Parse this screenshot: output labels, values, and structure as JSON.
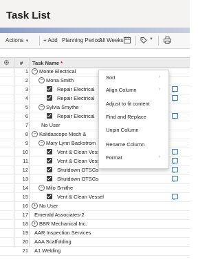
{
  "page": {
    "title": "Task List"
  },
  "toolbar": {
    "actions_label": "Actions",
    "add_label": "+ Add",
    "period_label": "Planning Period:",
    "period_value": "All Weeks"
  },
  "grid": {
    "row_header": "#",
    "name_header": "Task Name",
    "required_mark": "*",
    "rows": [
      {
        "num": "1",
        "name": "Monte Electrical",
        "toggle": "−",
        "check": false,
        "comment": false,
        "indent": 0
      },
      {
        "num": "2",
        "name": "Mona Smith",
        "toggle": "−",
        "check": false,
        "comment": false,
        "indent": 1
      },
      {
        "num": "3",
        "name": "Repair Electrical",
        "toggle": "",
        "check": true,
        "comment": true,
        "indent": 2
      },
      {
        "num": "4",
        "name": "Repair Electrical",
        "toggle": "",
        "check": true,
        "comment": true,
        "indent": 2
      },
      {
        "num": "5",
        "name": "Sylvia Smythe",
        "toggle": "−",
        "check": false,
        "comment": false,
        "indent": 1
      },
      {
        "num": "6",
        "name": "Repair Electrical",
        "toggle": "",
        "check": true,
        "comment": true,
        "indent": 2
      },
      {
        "num": "7",
        "name": "No User",
        "toggle": "",
        "check": false,
        "comment": false,
        "indent": 1
      },
      {
        "num": "8",
        "name": "Kalidascope Mech &",
        "toggle": "−",
        "check": false,
        "comment": false,
        "indent": 0
      },
      {
        "num": "9",
        "name": "Mary Lynn Backstrom",
        "toggle": "−",
        "check": false,
        "comment": false,
        "indent": 1
      },
      {
        "num": "10",
        "name": "Vent & Clean Vessel",
        "toggle": "",
        "check": true,
        "comment": true,
        "indent": 2
      },
      {
        "num": "11",
        "name": "Vent & Clean Vessel",
        "toggle": "",
        "check": true,
        "comment": true,
        "indent": 2
      },
      {
        "num": "12",
        "name": "Shutdown OTSGs",
        "toggle": "",
        "check": true,
        "comment": true,
        "indent": 2
      },
      {
        "num": "13",
        "name": "Shutdown OTSGs",
        "toggle": "",
        "check": true,
        "comment": true,
        "indent": 2
      },
      {
        "num": "14",
        "name": "Milo Smithe",
        "toggle": "−",
        "check": false,
        "comment": false,
        "indent": 1
      },
      {
        "num": "15",
        "name": "Vent & Clean Vessel",
        "toggle": "",
        "check": true,
        "comment": true,
        "indent": 2
      },
      {
        "num": "16",
        "name": "No User",
        "toggle": "+",
        "check": false,
        "comment": false,
        "indent": 0
      },
      {
        "num": "17",
        "name": "Emerald Associates-2",
        "toggle": "",
        "check": false,
        "comment": false,
        "indent": 0
      },
      {
        "num": "18",
        "name": "BBR Mechanical Inc.",
        "toggle": "+",
        "check": false,
        "comment": false,
        "indent": 0
      },
      {
        "num": "19",
        "name": "AAR Inspection Services",
        "toggle": "",
        "check": false,
        "comment": false,
        "indent": 0
      },
      {
        "num": "20",
        "name": "AAA Scaffolding",
        "toggle": "",
        "check": false,
        "comment": false,
        "indent": 0
      },
      {
        "num": "21",
        "name": "A1 Welding",
        "toggle": "",
        "check": false,
        "comment": false,
        "indent": 0
      }
    ]
  },
  "context_menu": {
    "items": [
      {
        "label": "Sort",
        "submenu": true
      },
      {
        "label": "Align Column",
        "submenu": true
      },
      {
        "label": "Adjust to fit content",
        "submenu": false
      },
      {
        "label": "Find and Replace",
        "submenu": false
      },
      {
        "label": "Unpin Column",
        "submenu": false
      },
      {
        "label": "Rename Column",
        "submenu": false
      },
      {
        "label": "Format",
        "submenu": true
      }
    ]
  }
}
